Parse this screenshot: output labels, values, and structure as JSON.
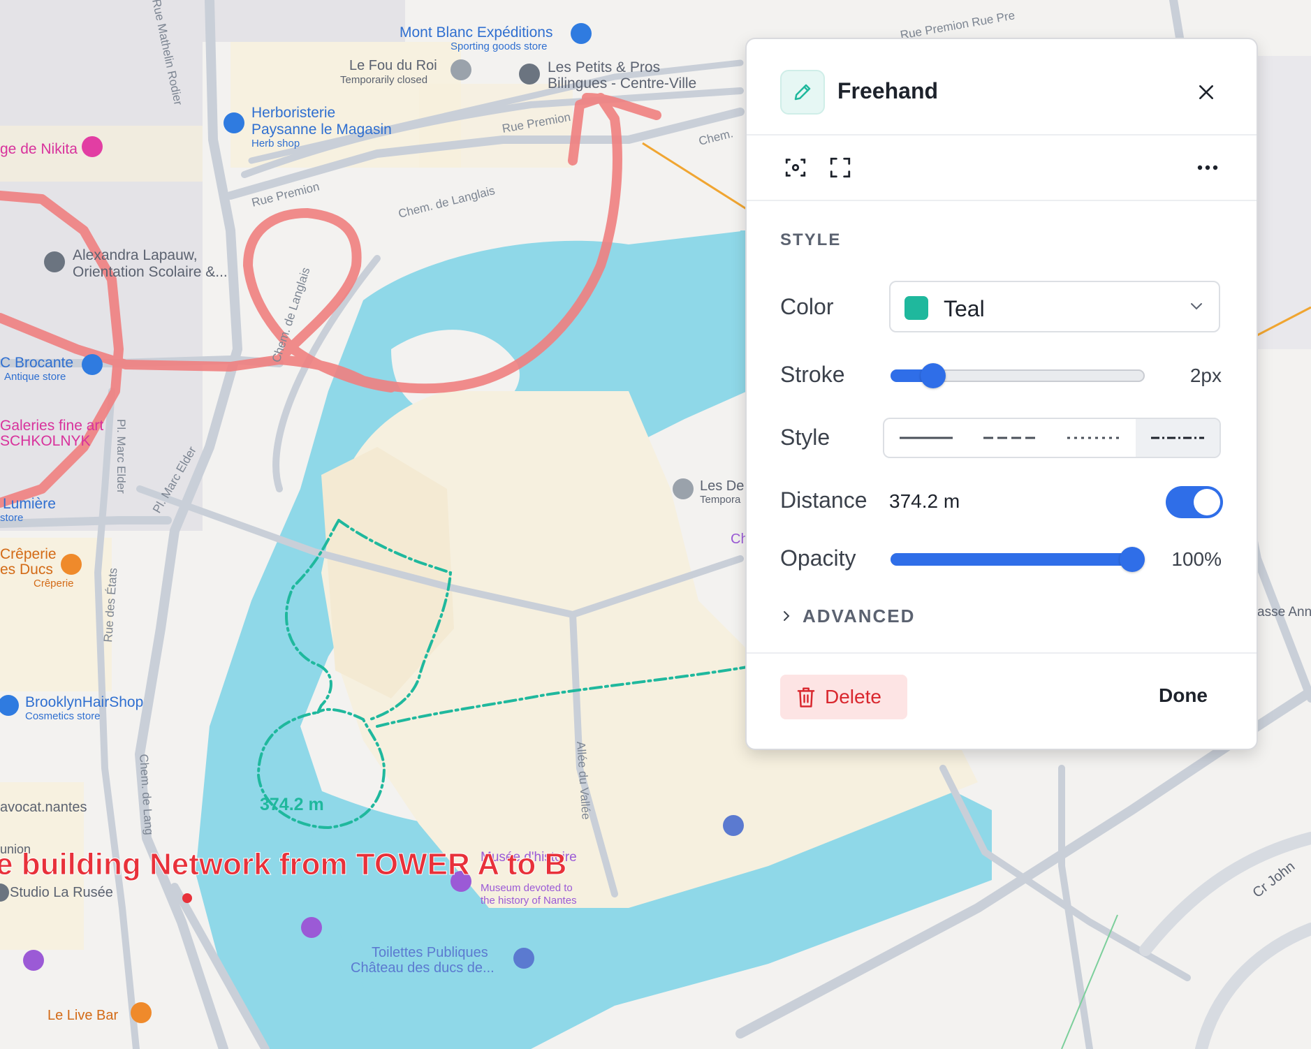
{
  "map": {
    "streets": [
      "Rue Premion",
      "Rue Premion",
      "Rue Premion",
      "Chem. de Langlais",
      "Chem. de Langlais",
      "Rue Mathelin Rodier",
      "Pl. Marc Elder",
      "Pl. Marc Elder",
      "Rue des États",
      "Rue des États",
      "Chem. de Langlais",
      "Chem. de Lang",
      "Allée du Vallée",
      "Chem.",
      "Cr John",
      "Rue Premion Rue Pre"
    ],
    "pois": {
      "mont_blanc": {
        "name": "Mont Blanc Expéditions",
        "sub": "Sporting goods store"
      },
      "fou_du_roi": {
        "name": "Le Fou du Roi",
        "sub": "Temporarily closed"
      },
      "petits_pros": {
        "name": "Les Petits & Pros",
        "sub": "Bilingues - Centre-Ville"
      },
      "herboristerie": {
        "name1": "Herboristerie",
        "name2": "Paysanne le Magasin",
        "sub": "Herb shop"
      },
      "nikita": {
        "name": "ge de Nikita"
      },
      "alexandra": {
        "name1": "Alexandra Lapauw,",
        "name2": "Orientation Scolaire &..."
      },
      "brocante": {
        "name": "C Brocante",
        "sub": "Antique store"
      },
      "galeries": {
        "name1": "Galeries fine art",
        "name2": "SCHKOLNYK"
      },
      "lumiere": {
        "name": "Lumière",
        "sub": "store"
      },
      "creperie": {
        "name1": "Crêperie",
        "name2": "es Ducs",
        "sub": "Crêperie"
      },
      "brooklyn": {
        "name": "BrooklynHairShop",
        "sub": "Cosmetics store"
      },
      "avocat": {
        "name": "avocat.nantes"
      },
      "union": {
        "name": "union"
      },
      "studio": {
        "name": "Studio La Rusée"
      },
      "les_de": {
        "name": "Les De",
        "sub": "Tempora"
      },
      "musee": {
        "name": "Musée d'histoire",
        "sub1": "Museum devoted to",
        "sub2": "the history of Nantes"
      },
      "toilettes": {
        "name1": "Toilettes Publiques",
        "name2": "Château des ducs de..."
      },
      "live_bar": {
        "name": "Le Live Bar"
      },
      "ch": {
        "name": "Ch"
      },
      "asse_ann": {
        "name": "asse Ann"
      }
    },
    "measurement_label": "374.2 m",
    "annotation_text": "e building Network from TOWER A to B",
    "colors": {
      "teal": "#1fb89d",
      "red": "#f08080",
      "annotation_red": "#e8313a",
      "water": "#8fd8e8"
    }
  },
  "panel": {
    "title": "Freehand",
    "tool_icon": "pencil-icon",
    "close_icon": "close-icon",
    "toolbar": [
      "focus-icon",
      "fullscreen-icon",
      "more-icon"
    ],
    "section": "STYLE",
    "color": {
      "label": "Color",
      "value": "Teal",
      "swatch": "#1fb89d"
    },
    "stroke": {
      "label": "Stroke",
      "value": "2px",
      "level": 0.13
    },
    "style": {
      "label": "Style",
      "options": [
        "solid",
        "dashed",
        "dotted",
        "dash-dot"
      ],
      "selected": "dash-dot"
    },
    "distance": {
      "label": "Distance",
      "value": "374.2 m",
      "enabled": true
    },
    "opacity": {
      "label": "Opacity",
      "value": "100%",
      "level": 1.0
    },
    "advanced_label": "ADVANCED",
    "delete_label": "Delete",
    "done_label": "Done",
    "accent": "#2f6ee8"
  }
}
